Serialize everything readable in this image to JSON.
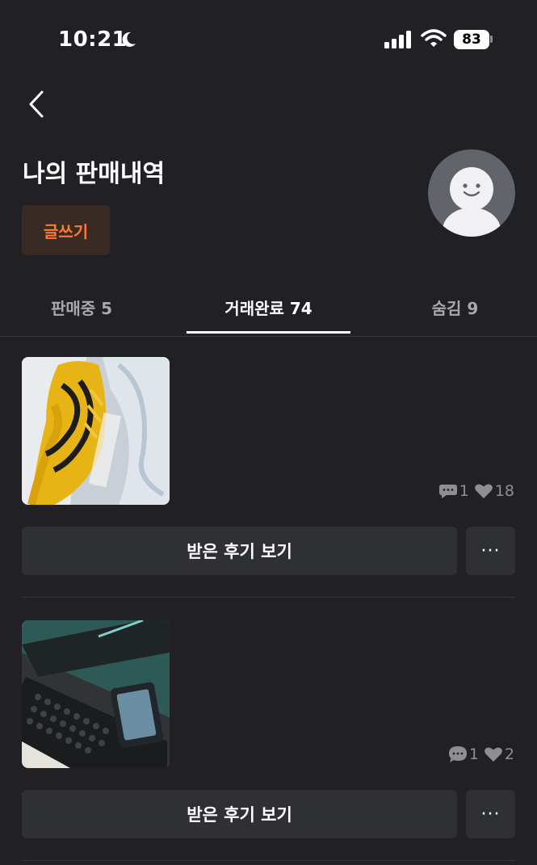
{
  "status_bar": {
    "time": "10:21",
    "battery": "83"
  },
  "header": {
    "title": "나의 판매내역",
    "write_button": "글쓰기"
  },
  "tabs": [
    {
      "label": "판매중 5",
      "active": false
    },
    {
      "label": "거래완료 74",
      "active": true
    },
    {
      "label": "숨김 9",
      "active": false
    }
  ],
  "items": [
    {
      "thumbnail": "yellow sneaker photo",
      "chats": "1",
      "likes": "18",
      "review_button": "받은 후기 보기",
      "more": "···"
    },
    {
      "thumbnail": "logitech keyboard photo",
      "chats": "1",
      "likes": "2",
      "review_button": "받은 후기 보기",
      "more": "···"
    }
  ],
  "colors": {
    "background": "#212125",
    "accent": "#ff7a2e",
    "button_bg": "#2f3034"
  }
}
